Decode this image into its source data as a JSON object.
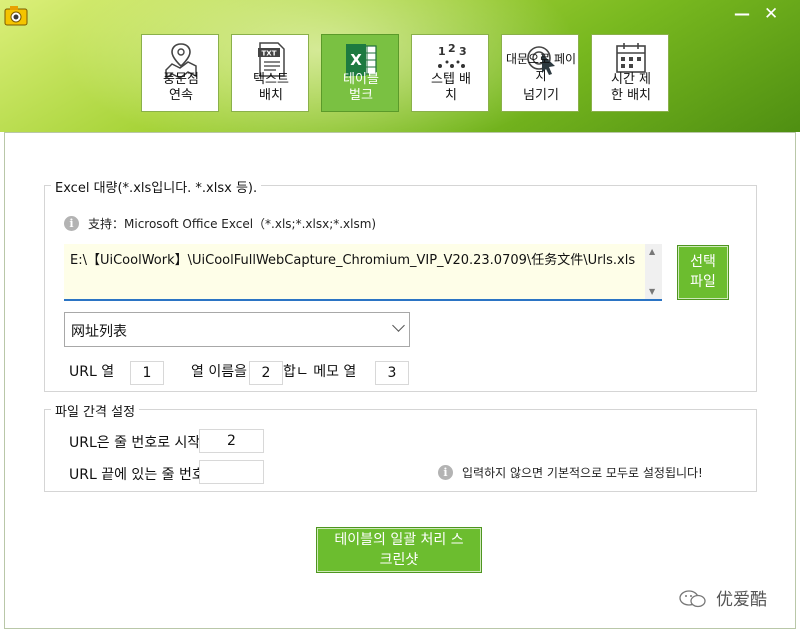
{
  "toolbar": {
    "tools": [
      {
        "line1": "풍문점",
        "line2": "연속",
        "icon": "map-pin-icon"
      },
      {
        "line1": "텍스트",
        "line2": "배치",
        "icon": "txt-file-icon"
      },
      {
        "line1": "테이블",
        "line2": "벌크",
        "icon": "excel-icon"
      },
      {
        "line1": "스텝 배",
        "line2": "치",
        "icon": "number-steps-icon"
      },
      {
        "line1": "대문으로 페이지",
        "line2": "넘기기",
        "icon": "page-cursor-icon"
      },
      {
        "line1": "시간 제",
        "line2": "한 배치",
        "icon": "calendar-icon"
      }
    ],
    "minimize": "—",
    "close": "✕"
  },
  "excel_group": {
    "title": "Excel 대량(*.xls입니다. *.xlsx 등).",
    "info": "支持：Microsoft Office Excel（*.xls;*.xlsx;*.xlsm)",
    "path": "E:\\【UiCoolWork】\\UiCoolFullWebCapture_Chromium_VIP_V20.23.0709\\任务文件\\Urls.xls",
    "select_button": [
      "선택",
      "파일"
    ],
    "sheet_select": "网址列表",
    "url_col_label": "URL 열",
    "url_col_value": "1",
    "name_col_label": "열 이름을",
    "name_col_value": "2",
    "memo_col_label": "합ㄴ 메모 열",
    "memo_col_value": "3"
  },
  "interval_group": {
    "title": "파일 간격 설정",
    "start_label": "URL은 줄 번호로 시작",
    "start_value": "2",
    "end_label": "URL 끝에 있는 줄 번호",
    "end_value": "",
    "hint": "입력하지 않으면 기본적으로 모두로 설정됩니다!"
  },
  "action_button": [
    "테이블의 일괄 처리 스",
    "크린샷"
  ],
  "watermark": "优爱酷",
  "colors": {
    "accent": "#6cbd2f",
    "header_dark": "#4f8f12",
    "input_bg": "#fefee8",
    "focus_border": "#2b74c4"
  }
}
